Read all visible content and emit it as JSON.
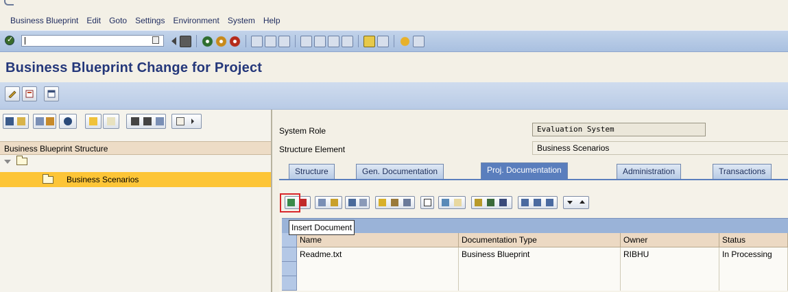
{
  "menu": [
    "Business Blueprint",
    "Edit",
    "Goto",
    "Settings",
    "Environment",
    "System",
    "Help"
  ],
  "title": "Business Blueprint Change for Project",
  "tree": {
    "header": "Business Blueprint Structure",
    "selected_node": "Business Scenarios"
  },
  "fields": {
    "system_role_label": "System Role",
    "system_role_value": "Evaluation System",
    "structure_element_label": "Structure Element",
    "structure_element_value": "Business Scenarios"
  },
  "tabs": [
    {
      "label": "Structure",
      "active": false
    },
    {
      "label": "Gen. Documentation",
      "active": false
    },
    {
      "label": "Proj. Documentation",
      "active": true
    },
    {
      "label": "Administration",
      "active": false
    },
    {
      "label": "Transactions",
      "active": false
    }
  ],
  "tooltip": "Insert Document",
  "table": {
    "columns": [
      "Name",
      "Documentation Type",
      "Owner",
      "Status"
    ],
    "rows": [
      [
        "Readme.txt",
        "Business Blueprint",
        "RIBHU",
        "In Processing"
      ]
    ]
  },
  "colors": {
    "title": "#24377a",
    "selection": "#fdc537",
    "tab_active": "#5a7ebd",
    "highlight": "#d8262b"
  }
}
